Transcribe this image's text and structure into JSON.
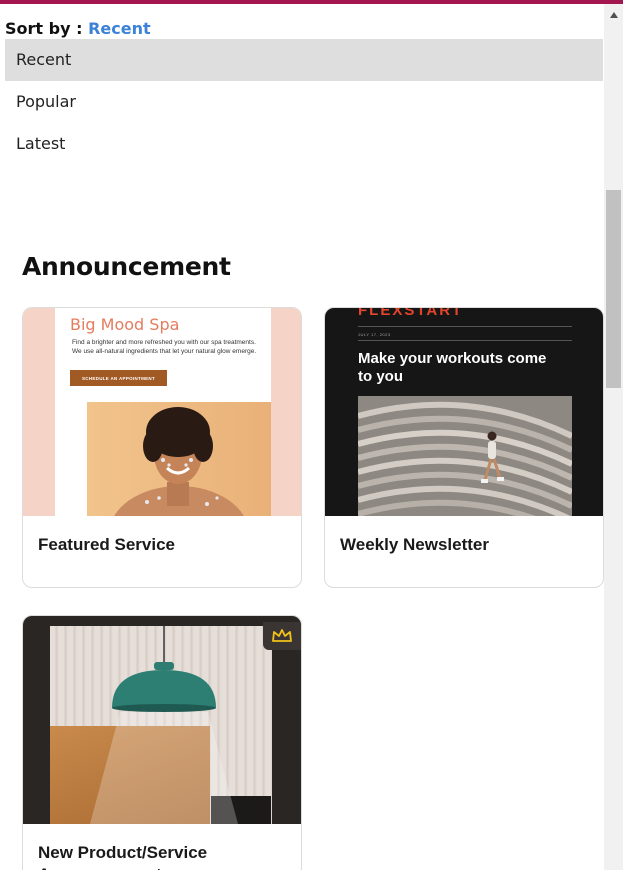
{
  "sort": {
    "label": "Sort by :",
    "value": "Recent",
    "options": [
      {
        "label": "Recent",
        "selected": true
      },
      {
        "label": "Popular",
        "selected": false
      },
      {
        "label": "Latest",
        "selected": false
      }
    ]
  },
  "section": {
    "title": "Announcement"
  },
  "cards": [
    {
      "caption": "Featured Service",
      "thumb": {
        "brand": "Big Mood Spa",
        "copy": "Find a brighter and more refreshed you with our spa treatments. We use all-natural ingredients that let your natural glow emerge.",
        "cta": "SCHEDULE AN APPOINTMENT"
      }
    },
    {
      "caption": "Weekly Newsletter",
      "thumb": {
        "logo": "FLEXSTART",
        "date": "JULY 17, 2023",
        "headline": "Make your workouts come to you"
      }
    },
    {
      "caption": "New Product/Service Announcement",
      "premium_icon": "crown-icon"
    }
  ],
  "colors": {
    "accent_bar": "#a3164f",
    "sort_value": "#3b82d8",
    "selected_option_bg": "#dedede",
    "premium_crown": "#f2c21a"
  }
}
